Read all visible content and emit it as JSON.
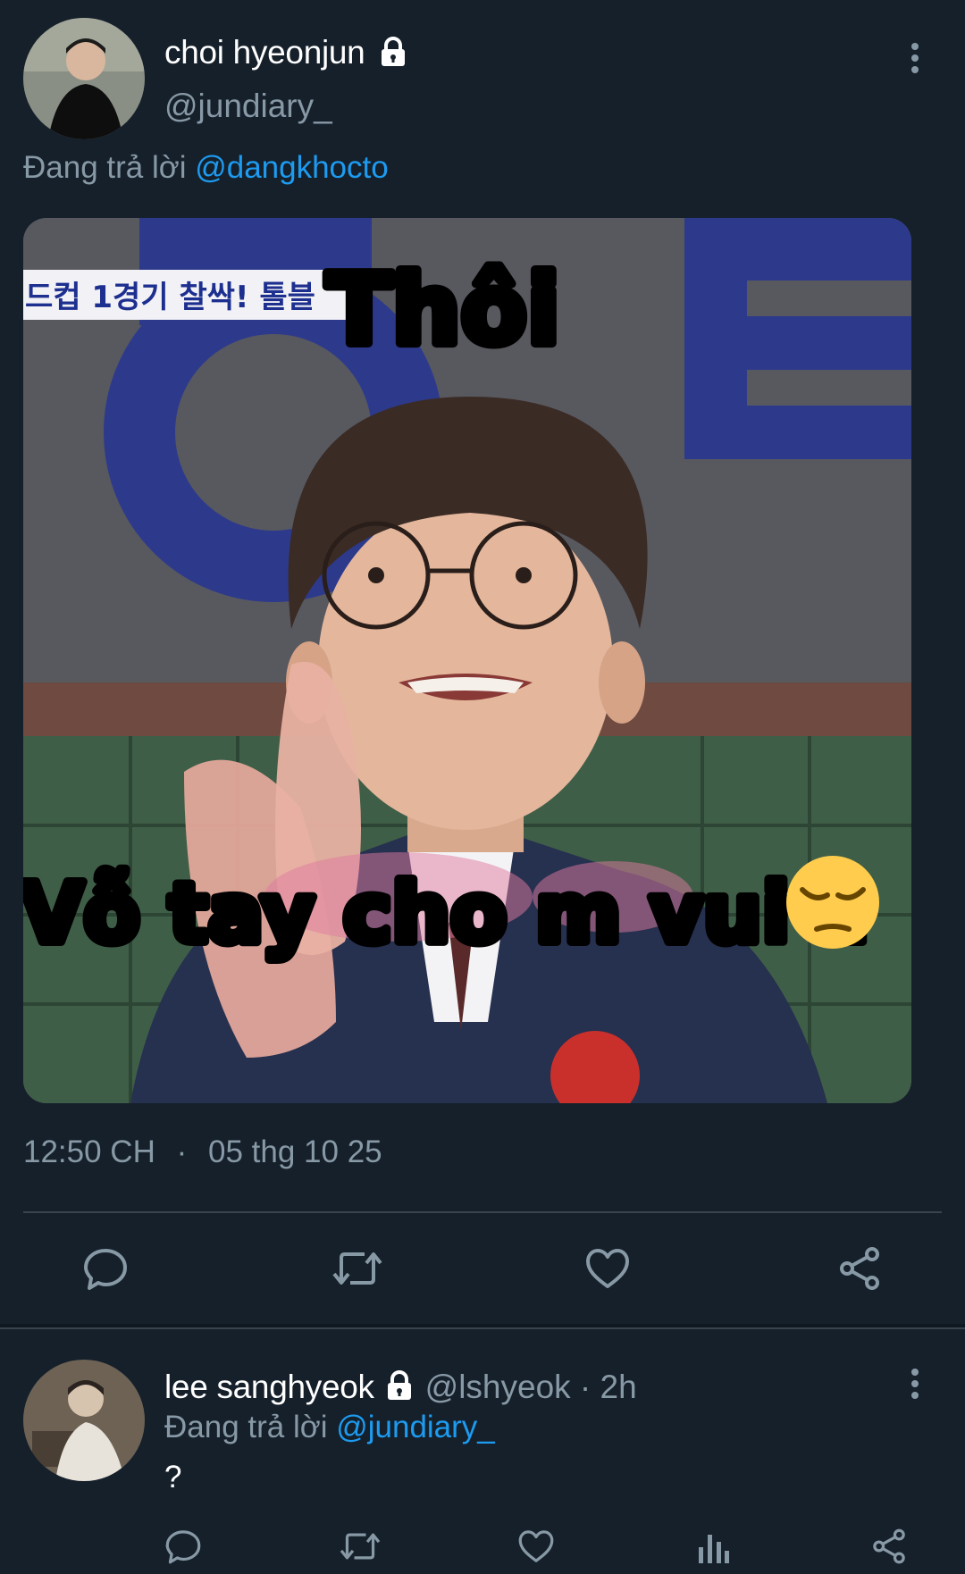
{
  "tweet": {
    "author_name": "choi hyeonjun",
    "handle": "@jundiary_",
    "reply_prefix": "Đang trả lời",
    "reply_to": "@dangkhocto",
    "meme_top_text": "Thôi",
    "meme_bottom_text": "Vỗ tay cho m vui z",
    "meme_emoji": "😔",
    "banner_text": "드컵 1경기 찰싹! 톨블",
    "time": "12:50 CH",
    "dot": "·",
    "date": "05 thg 10 25"
  },
  "reply": {
    "author_name": "lee sanghyeok",
    "handle_time": "@lshyeok · 2h",
    "reply_prefix": "Đang trả lời",
    "reply_to": "@jundiary_",
    "text": "?"
  },
  "colors": {
    "background": "#15202b",
    "secondary_text": "#8899a6",
    "link": "#1d9bf0",
    "divider": "#38444d"
  },
  "icons": {
    "lock": "lock-icon",
    "more": "more-vertical-icon",
    "reply": "reply-icon",
    "retweet": "retweet-icon",
    "like": "heart-icon",
    "share": "share-icon",
    "stats": "stats-icon"
  }
}
